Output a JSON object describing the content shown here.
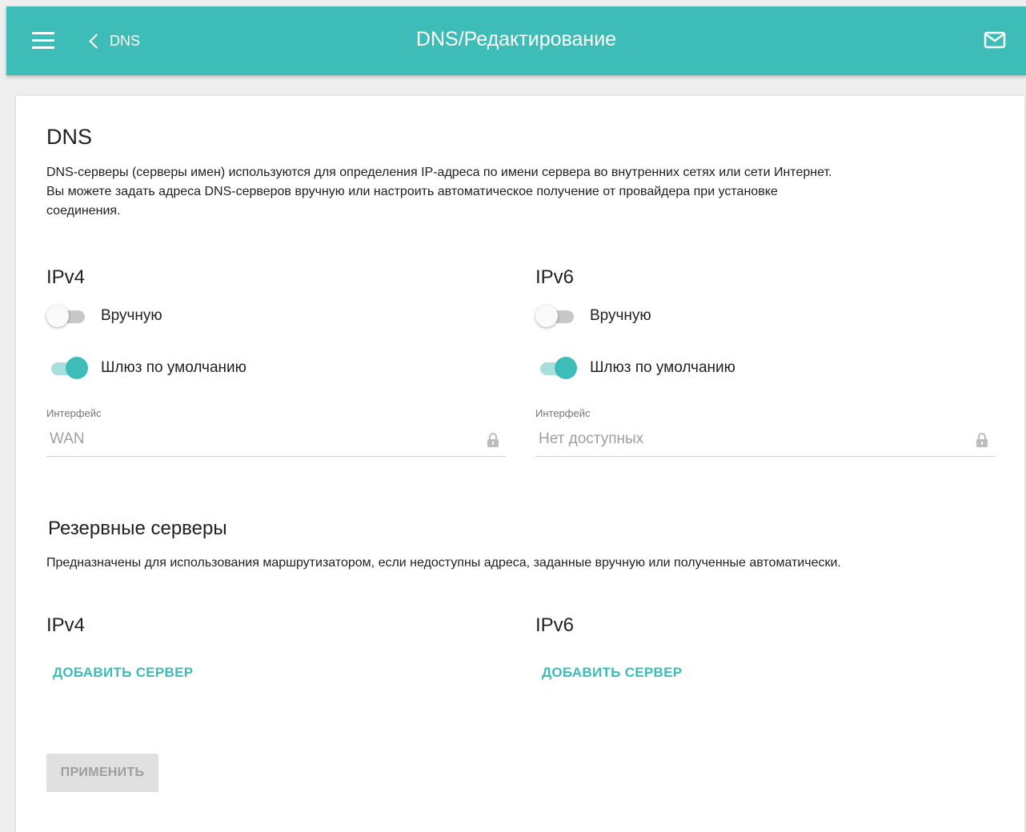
{
  "header": {
    "back_label": "DNS",
    "title": "DNS/Редактирование"
  },
  "dns": {
    "title": "DNS",
    "description_line1": "DNS-серверы (серверы имен) используются для определения IP-адреса по имени сервера во внутренних сетях или сети Интернет.",
    "description_line2": "Вы можете задать адреса DNS-серверов вручную или настроить автоматическое получение от провайдера при установке",
    "description_line3": "соединения.",
    "ipv4": {
      "title": "IPv4",
      "manual_label": "Вручную",
      "manual_enabled": false,
      "gateway_label": "Шлюз по умолчанию",
      "gateway_enabled": true,
      "interface_label": "Интерфейс",
      "interface_value": "WAN"
    },
    "ipv6": {
      "title": "IPv6",
      "manual_label": "Вручную",
      "manual_enabled": false,
      "gateway_label": "Шлюз по умолчанию",
      "gateway_enabled": true,
      "interface_label": "Интерфейс",
      "interface_value": "Нет доступных"
    }
  },
  "backup": {
    "title": "Резервные серверы",
    "description": "Предназначены для использования маршрутизатором, если недоступны адреса, заданные вручную или полученные автоматически.",
    "ipv4_title": "IPv4",
    "ipv4_add_label": "ДОБАВИТЬ СЕРВЕР",
    "ipv6_title": "IPv6",
    "ipv6_add_label": "ДОБАВИТЬ СЕРВЕР"
  },
  "apply_label": "ПРИМЕНИТЬ",
  "colors": {
    "accent": "#3dbcb8",
    "accent_light": "#a8dedc",
    "disabled_text": "#9e9e9e",
    "disabled_bg": "#e0e0e0"
  }
}
